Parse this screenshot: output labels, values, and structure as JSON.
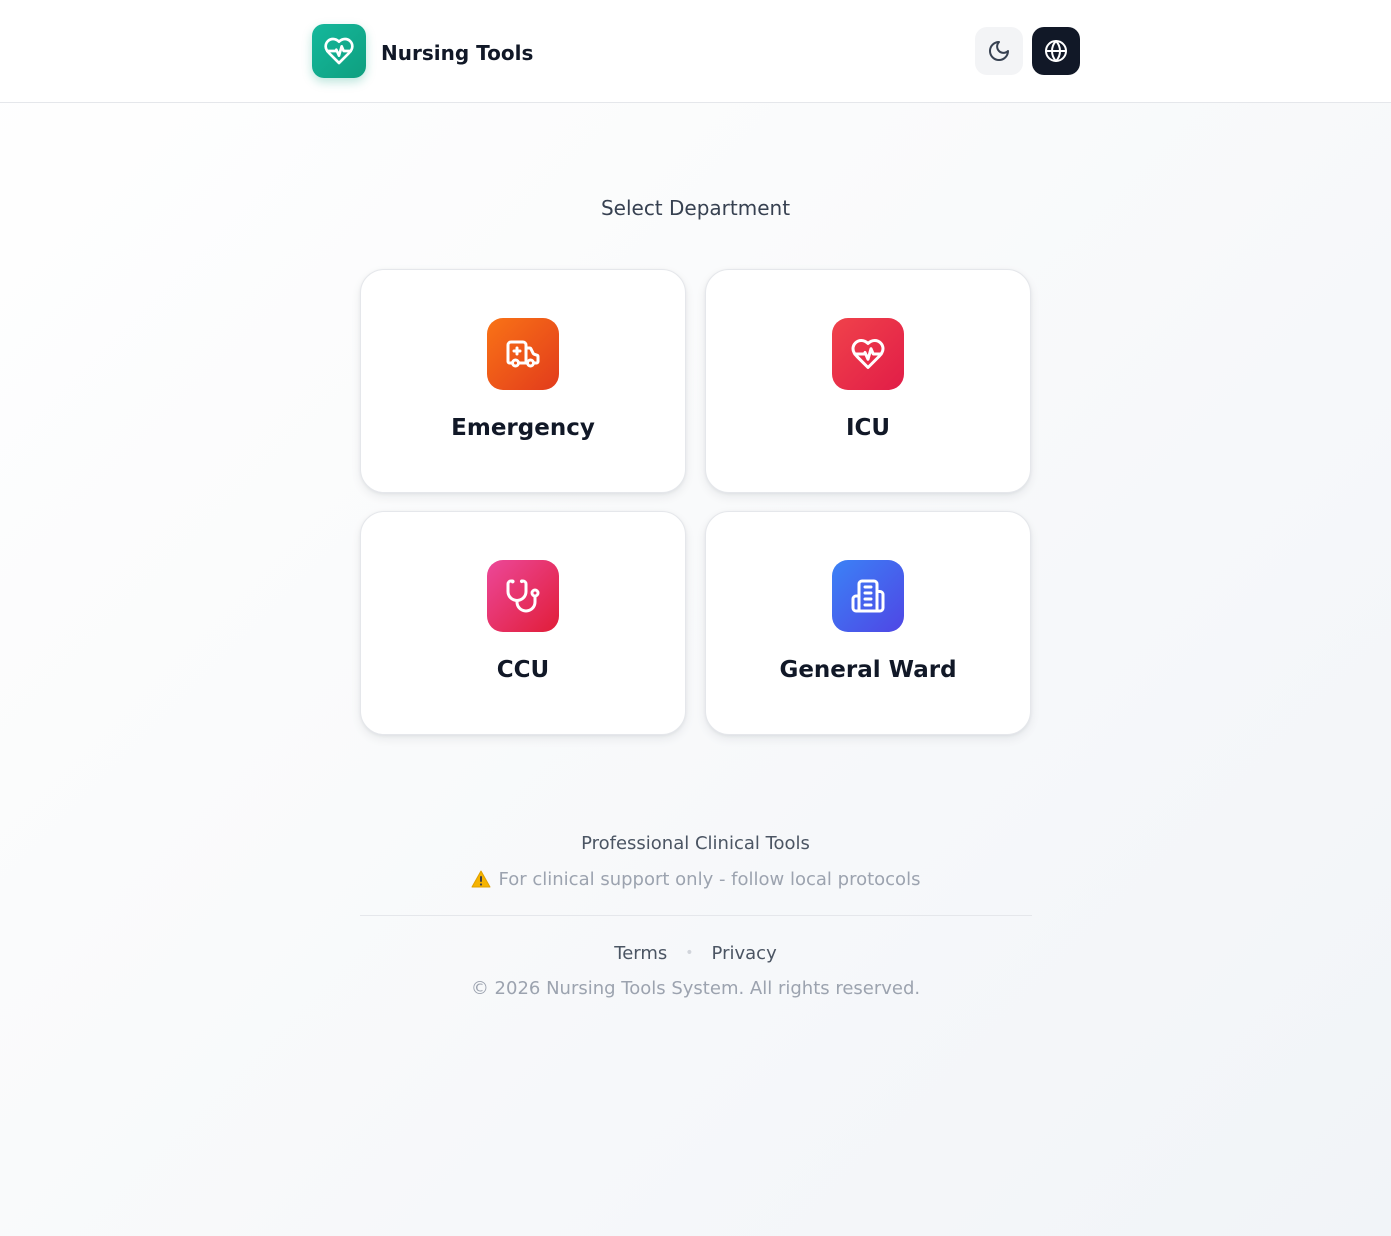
{
  "header": {
    "app_title": "Nursing Tools",
    "logo_icon": "heart-pulse-icon",
    "theme_icon": "moon-icon",
    "language_icon": "globe-icon"
  },
  "main": {
    "section_title": "Select Department",
    "departments": [
      {
        "label": "Emergency",
        "icon": "ambulance-icon",
        "color": "#f97316"
      },
      {
        "label": "ICU",
        "icon": "heart-pulse-icon",
        "color": "#ef4444"
      },
      {
        "label": "CCU",
        "icon": "stethoscope-icon",
        "color": "#ec4899"
      },
      {
        "label": "General Ward",
        "icon": "hospital-building-icon",
        "color": "#3b82f6"
      }
    ]
  },
  "footer": {
    "heading": "Professional Clinical Tools",
    "note": "For clinical support only - follow local protocols",
    "note_icon": "warning-icon",
    "links": {
      "terms": "Terms",
      "privacy": "Privacy"
    },
    "copyright": "© 2026 Nursing Tools System. All rights reserved."
  },
  "colors": {
    "brand": "#10b08f",
    "text_dark": "#111827",
    "muted": "#9ca3af"
  }
}
